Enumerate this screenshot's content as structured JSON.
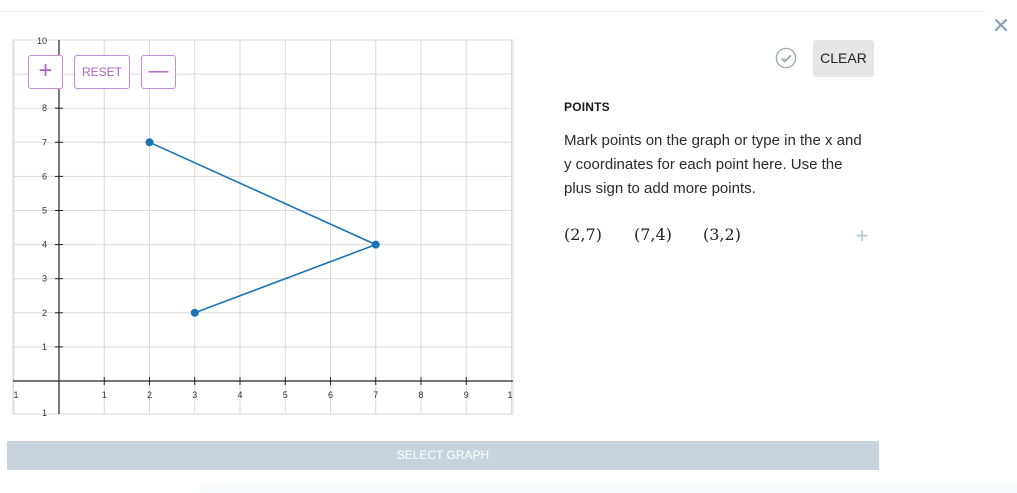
{
  "window": {
    "close_icon": "close-icon"
  },
  "controls": {
    "plus_label": "+",
    "reset_label": "RESET",
    "minus_label": "—"
  },
  "graph": {
    "x_ticks": [
      "1",
      "1",
      "2",
      "3",
      "4",
      "5",
      "6",
      "7",
      "8",
      "9",
      "1"
    ],
    "y_ticks": [
      "10",
      "8",
      "7",
      "6",
      "5",
      "4",
      "3",
      "2",
      "1",
      "1"
    ],
    "xlim": [
      -1,
      10
    ],
    "ylim": [
      -1,
      10
    ],
    "grid": true,
    "line_color": "#1a73b5",
    "grid_color": "#d9d9d9"
  },
  "chart_data": {
    "type": "line",
    "x": [
      2,
      7,
      3
    ],
    "y": [
      7,
      4,
      2
    ],
    "xlim": [
      -1,
      10
    ],
    "ylim": [
      -1,
      10
    ],
    "grid": true
  },
  "panel": {
    "check_icon": "check-circle-icon",
    "clear_label": "CLEAR",
    "heading": "POINTS",
    "instructions": "Mark points on the graph or type in the x and y coordinates for each point here. Use the plus sign to add more points.",
    "points": [
      "(2,7)",
      "(7,4)",
      "(3,2)"
    ],
    "add_label": "+"
  },
  "footer": {
    "select_graph_label": "SELECT GRAPH"
  }
}
